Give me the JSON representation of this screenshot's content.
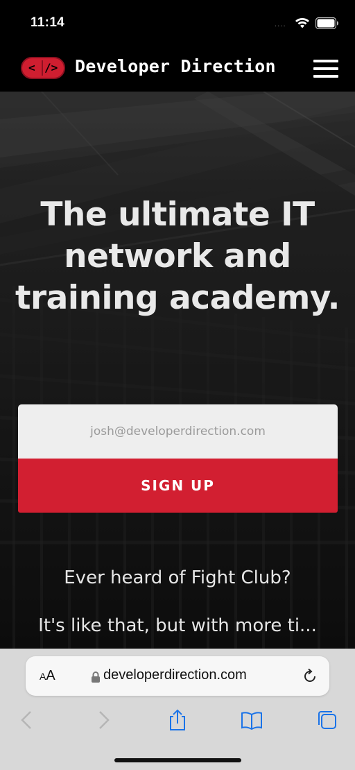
{
  "status_bar": {
    "time": "11:14",
    "signal": "....",
    "icons": [
      "wifi-icon",
      "battery-icon"
    ]
  },
  "navbar": {
    "logo_left": "<",
    "logo_right": "/>",
    "brand": "Developer Direction",
    "menu_icon": "hamburger-menu-icon",
    "accent_color": "#cf1e30"
  },
  "hero": {
    "title": "The ultimate IT network and training academy.",
    "email_placeholder": "josh@developerdirection.com",
    "signup_label": "SIGN UP",
    "tagline_1": "Ever heard of Fight Club?",
    "tagline_2": "It's like that, but with more ti..."
  },
  "browser": {
    "text_size_small": "A",
    "text_size_big": "A",
    "url": "developerdirection.com",
    "toolbar_icons": [
      "back-icon",
      "forward-icon",
      "share-icon",
      "bookmarks-icon",
      "tabs-icon"
    ],
    "link_color": "#1a73e8"
  }
}
